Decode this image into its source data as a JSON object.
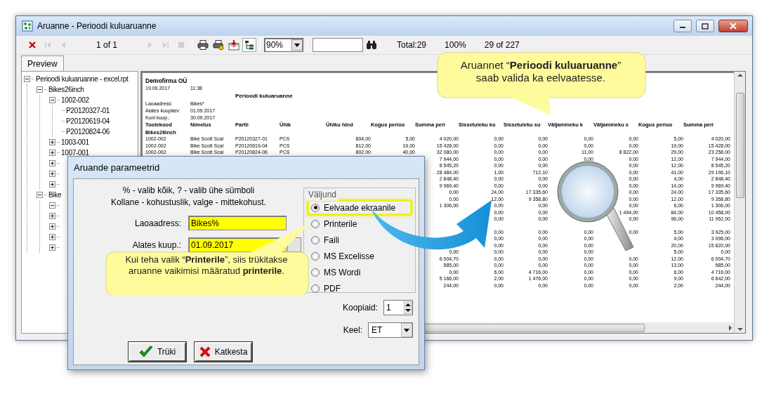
{
  "window": {
    "title": "Aruanne - Perioodi kuluaruanne"
  },
  "toolbar": {
    "groups": [
      [
        {
          "kind": "close",
          "disabled": false,
          "pressed": false
        },
        {
          "kind": "first",
          "disabled": true,
          "pressed": false
        },
        {
          "kind": "prev",
          "disabled": true,
          "pressed": false
        },
        {
          "kind": "page",
          "text": "1 of 1"
        },
        {
          "kind": "next",
          "disabled": true,
          "pressed": false
        },
        {
          "kind": "last",
          "disabled": true,
          "pressed": false
        },
        {
          "kind": "stop",
          "disabled": true,
          "pressed": false
        }
      ],
      [
        {
          "kind": "print",
          "disabled": false,
          "pressed": false
        },
        {
          "kind": "print_setup",
          "disabled": false,
          "pressed": false
        },
        {
          "kind": "export",
          "disabled": false,
          "pressed": false
        },
        {
          "kind": "tree",
          "disabled": false,
          "pressed": true
        }
      ],
      [
        {
          "kind": "zoom",
          "value": "90%"
        }
      ],
      [
        {
          "kind": "find_field"
        },
        {
          "kind": "find",
          "disabled": false,
          "pressed": false
        },
        {
          "kind": "label",
          "text": "Total:29"
        },
        {
          "kind": "label",
          "text": "100%"
        },
        {
          "kind": "label",
          "text": "29 of 227"
        }
      ]
    ]
  },
  "tabs": [
    {
      "label": "Preview",
      "selected": true
    }
  ],
  "tree": [
    {
      "label": "Perioodi kuluaruanne - excel.rpt",
      "expanded": true,
      "children": [
        {
          "label": "Bikes26inch",
          "expanded": true,
          "children": [
            {
              "label": "1002-002",
              "expanded": true,
              "children": [
                {
                  "label": "P20120327-01"
                },
                {
                  "label": "P20120619-04"
                },
                {
                  "label": "P20120824-06"
                }
              ]
            },
            {
              "label": "1003-001",
              "expanded": false
            },
            {
              "label": "1007-001",
              "expanded": false
            },
            {
              "expanded": false
            },
            {
              "expanded": false
            },
            {
              "expanded": false
            }
          ]
        },
        {
          "label": "Bike",
          "expanded": true,
          "children": [
            {
              "expanded": true
            },
            {
              "expanded": false
            },
            {
              "expanded": false
            },
            {
              "expanded": false
            },
            {
              "expanded": false
            }
          ]
        }
      ]
    }
  ],
  "report": {
    "company": "Demofirma OÜ",
    "date": "19.09.2017",
    "time": "11:38",
    "title": "Perioodi kuluaruanne",
    "filters": [
      {
        "label": "Laoaadress:",
        "value": "Bikes*"
      },
      {
        "label": "Alates kuupäev:",
        "value": "01.09.2017"
      },
      {
        "label": "Kuni kuup.:",
        "value": "30.09.2017"
      }
    ],
    "columns": [
      "Tootekood",
      "Nimetus",
      "Partii",
      "Ühik",
      "Ühiku hind",
      "Kogus perioo",
      "Summa peri",
      "Sissetuleku ko",
      "Sissetuleku su",
      "Väljamineku k",
      "Väljamineku s",
      "Kogus perioo",
      "Summa peri"
    ],
    "sections": [
      {
        "group": "Bikes26inch",
        "rows": [
          {
            "code": "1002-002",
            "name": "Bike Scott Scal",
            "batch": "P20120327-01",
            "unit": "PCS",
            "unit_price": "804,00",
            "qty_start": "5,00",
            "sum_start": "4 020,00",
            "in_qty": "0,00",
            "in_sum": "0,00",
            "out_qty": "0,00",
            "out_sum": "0,00",
            "qty_end": "5,00",
            "sum_end": "4 020,00"
          },
          {
            "code": "1002-002",
            "name": "Bike Scott Scal",
            "batch": "P20120619-04",
            "unit": "PCS",
            "unit_price": "812,00",
            "qty_start": "19,00",
            "sum_start": "15 428,00",
            "in_qty": "0,00",
            "in_sum": "0,00",
            "out_qty": "0,00",
            "out_sum": "0,00",
            "qty_end": "19,00",
            "sum_end": "15 428,00"
          },
          {
            "code": "1002-002",
            "name": "Bike Scott Scal",
            "batch": "P20120824-06",
            "unit": "PCS",
            "unit_price": "802,00",
            "qty_start": "40,00",
            "sum_start": "32 080,00",
            "in_qty": "0,00",
            "in_sum": "0,00",
            "out_qty": "11,00",
            "out_sum": "8 822,00",
            "qty_end": "29,00",
            "sum_end": "23 258,00"
          },
          {
            "sum_start": "7 944,00",
            "in_qty": "0,00",
            "in_sum": "0,00",
            "out_qty": "0,00",
            "out_sum": "0,00",
            "qty_end": "12,00",
            "sum_end": "7 944,00"
          },
          {
            "sum_start": "8 545,20",
            "in_qty": "0,00",
            "in_sum": "0,00",
            "out_sum": "0,00",
            "qty_end": "12,00",
            "sum_end": "8 545,20"
          },
          {
            "sum_start": "28 484,00",
            "in_qty": "1,00",
            "in_sum": "712,10",
            "out_sum": "0,00",
            "qty_end": "41,00",
            "sum_end": "29 196,10"
          },
          {
            "sum_start": "2 848,40",
            "in_qty": "0,00",
            "in_sum": "0,00",
            "out_sum": "0,00",
            "qty_end": "4,00",
            "sum_end": "2 848,40"
          },
          {
            "sum_start": "9 969,40",
            "in_qty": "0,00",
            "in_sum": "0,00",
            "out_sum": "0,00",
            "qty_end": "14,00",
            "sum_end": "9 969,40"
          },
          {
            "sum_start": "0,00",
            "in_qty": "24,00",
            "in_sum": "17 335,60",
            "out_sum": "0,00",
            "qty_end": "24,00",
            "sum_end": "17 335,60"
          },
          {
            "sum_start": "0,00",
            "in_qty": "12,00",
            "in_sum": "9 358,80",
            "out_sum": "0,00",
            "qty_end": "12,00",
            "sum_end": "9 358,80"
          },
          {
            "sum_start": "1 306,00",
            "in_qty": "0,00",
            "in_sum": "0,00",
            "out_sum": "0,00",
            "qty_end": "6,00",
            "sum_end": "1 306,00"
          },
          {
            "in_qty": "0,00",
            "in_sum": "0,00",
            "out_sum": "1 494,00",
            "qty_end": "84,00",
            "sum_end": "10 458,00"
          },
          {
            "in_qty": "0,00",
            "in_sum": "0,00",
            "out_sum": "0,00",
            "qty_end": "96,00",
            "sum_end": "11 952,00"
          }
        ]
      },
      {
        "rows": [
          {
            "in_qty": "0,00",
            "in_sum": "0,00",
            "out_qty": "0,00",
            "out_sum": "0,00",
            "qty_end": "5,00",
            "sum_end": "3 925,00"
          },
          {
            "in_qty": "0,00",
            "in_sum": "0,00",
            "out_qty": "0,00",
            "qty_end": "4,00",
            "sum_end": "3 096,00"
          },
          {
            "in_qty": "0,00",
            "in_sum": "0,00",
            "out_qty": "0,00",
            "qty_end": "20,00",
            "sum_end": "15 820,00"
          },
          {
            "sum_start": "0,00",
            "in_qty": "0,00",
            "in_sum": "0,00",
            "out_qty": "0,00",
            "qty_end": "5,00",
            "sum_end": "0,00"
          },
          {
            "sum_start": "6 004,70",
            "in_qty": "0,00",
            "in_sum": "0,00",
            "out_qty": "0,00",
            "out_sum": "0,00",
            "qty_end": "12,00",
            "sum_end": "6 004,70"
          },
          {
            "sum_start": "585,00",
            "in_qty": "0,00",
            "in_sum": "0,00",
            "out_qty": "0,00",
            "out_sum": "0,00",
            "qty_end": "13,00",
            "sum_end": "585,00"
          },
          {
            "sum_start": "0,00",
            "in_qty": "6,00",
            "in_sum": "4 716,00",
            "out_qty": "0,00",
            "out_sum": "0,00",
            "qty_end": "6,00",
            "sum_end": "4 716,00"
          },
          {
            "sum_start": "5 166,00",
            "in_qty": "2,00",
            "in_sum": "1 476,00",
            "out_qty": "0,00",
            "out_sum": "0,00",
            "qty_end": "9,00",
            "sum_end": "6 642,00"
          },
          {
            "sum_start": "244,00",
            "in_qty": "0,00",
            "in_sum": "0,00",
            "out_qty": "0,00",
            "out_sum": "0,00",
            "qty_end": "2,00",
            "sum_end": "244,00"
          }
        ]
      }
    ]
  },
  "dialog": {
    "title": "Aruande parameetrid",
    "hints": [
      "% - valib kõik, ? - valib ühe sümboli",
      "Kollane - kohustuslik, valge - mittekohust."
    ],
    "fields": [
      {
        "label": "Laoaadress:",
        "value": "Bikes%",
        "required": true,
        "kind": "text"
      },
      {
        "label": "Alates kuup.:",
        "value": "01.09.2017",
        "required": true,
        "kind": "date"
      }
    ],
    "output": {
      "legend": "Väljund",
      "options": [
        {
          "label": "Eelvaade ekraanile",
          "selected": true,
          "highlighted": true
        },
        {
          "label": "Printerile",
          "selected": false,
          "highlighted": false
        },
        {
          "label": "Faili",
          "selected": false,
          "highlighted": false
        },
        {
          "label": "MS Excelisse",
          "selected": false,
          "highlighted": false
        },
        {
          "label": "MS Wordi",
          "selected": false,
          "highlighted": false
        },
        {
          "label": "PDF",
          "selected": false,
          "highlighted": false
        }
      ]
    },
    "copies": {
      "label": "Koopiaid:",
      "value": "1"
    },
    "language": {
      "label": "Keel:",
      "value": "ET"
    },
    "buttons": [
      {
        "label": "Trüki",
        "kind": "ok"
      },
      {
        "label": "Katkesta",
        "kind": "cancel"
      }
    ]
  },
  "callouts": [
    {
      "text": "Aruannet “**Perioodi kuluaruanne**” saab valida ka eelvaatesse.",
      "kind": "down"
    },
    {
      "text": "Kui teha valik “**Printerile**”, siis trükitakse aruanne vaikimisi määratud **printerile**.",
      "kind": "up"
    }
  ]
}
